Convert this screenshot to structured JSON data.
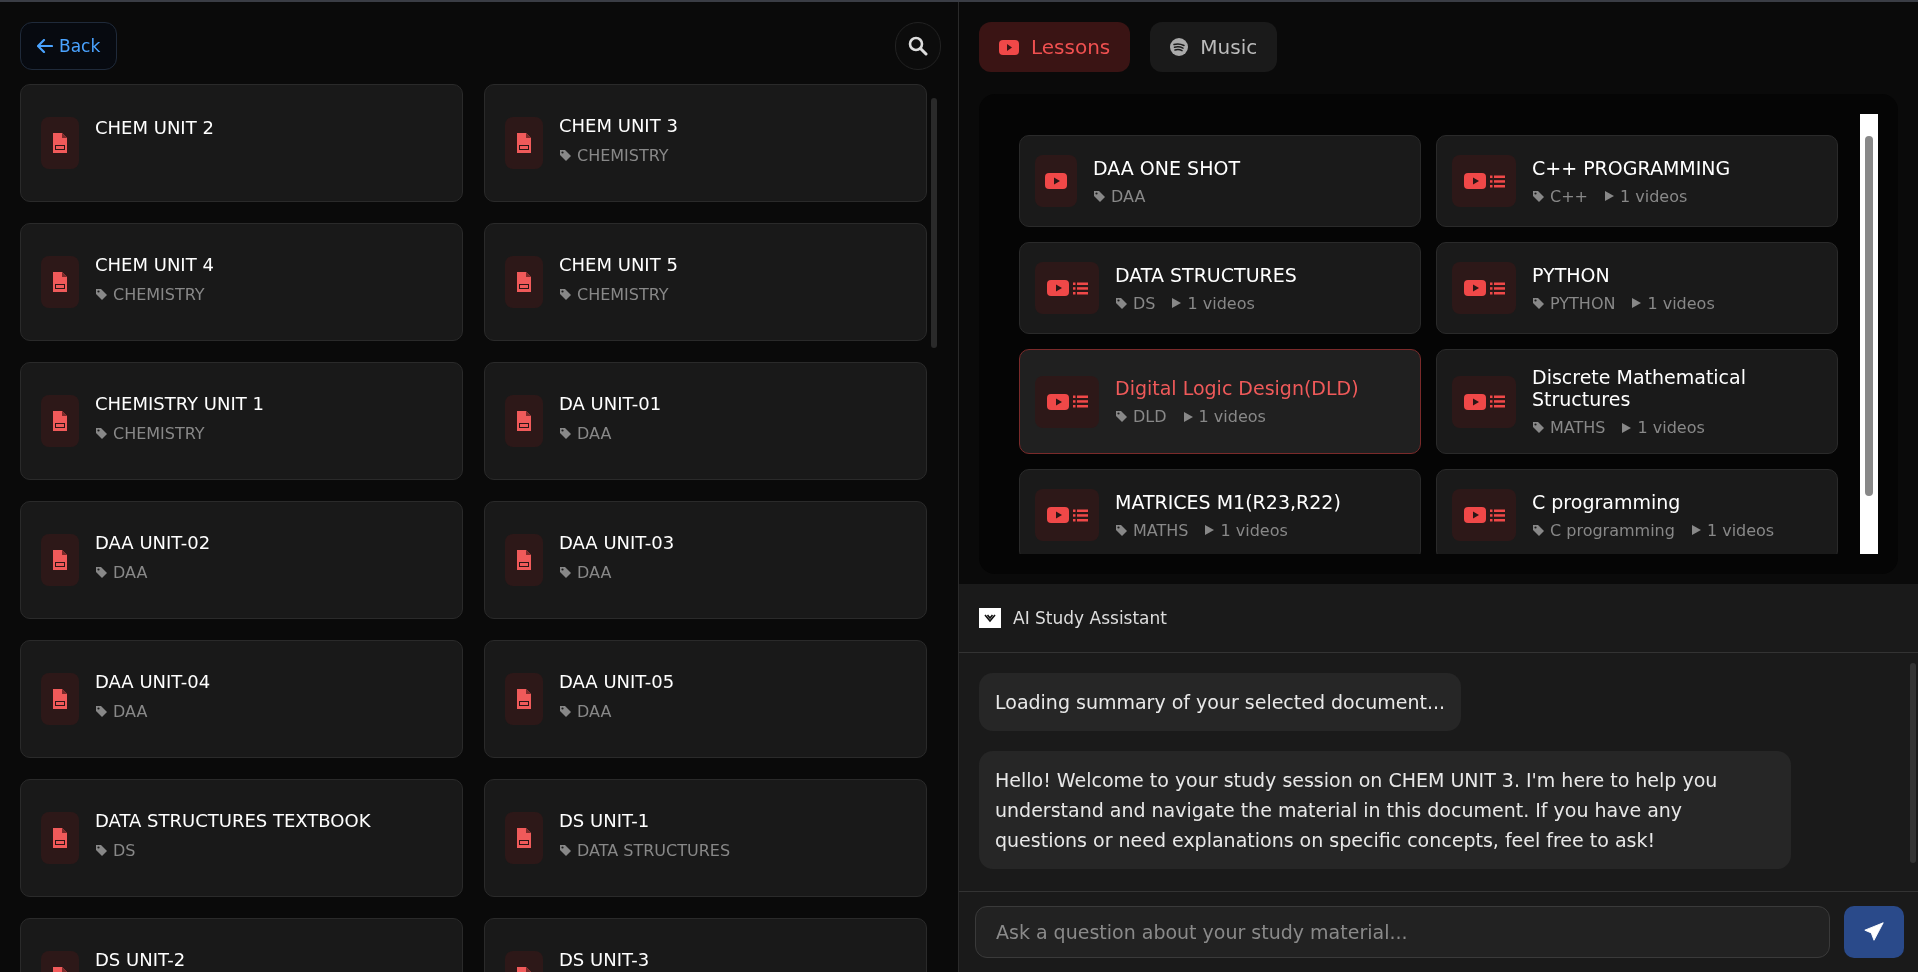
{
  "header": {
    "back": "Back"
  },
  "documents": [
    {
      "title": "CHEM UNIT 2"
    },
    {
      "title": "CHEM UNIT 3",
      "tag": "CHEMISTRY"
    },
    {
      "title": "CHEM UNIT 4",
      "tag": "CHEMISTRY"
    },
    {
      "title": "CHEM UNIT 5",
      "tag": "CHEMISTRY"
    },
    {
      "title": "CHEMISTRY UNIT 1",
      "tag": "CHEMISTRY"
    },
    {
      "title": "DA UNIT-01",
      "tag": "DAA"
    },
    {
      "title": "DAA UNIT-02",
      "tag": "DAA"
    },
    {
      "title": "DAA UNIT-03",
      "tag": "DAA"
    },
    {
      "title": "DAA UNIT-04",
      "tag": "DAA"
    },
    {
      "title": "DAA UNIT-05",
      "tag": "DAA"
    },
    {
      "title": "DATA STRUCTURES TEXTBOOK",
      "tag": "DS"
    },
    {
      "title": "DS UNIT-1",
      "tag": "DATA STRUCTURES"
    },
    {
      "title": "DS UNIT-2"
    },
    {
      "title": "DS UNIT-3"
    }
  ],
  "tabs": [
    {
      "label": "Lessons",
      "kind": "video",
      "selected": true
    },
    {
      "label": "Music",
      "kind": "music",
      "selected": false
    }
  ],
  "lessons": [
    {
      "title": "DAA ONE SHOT",
      "tag": "DAA",
      "kind": "video",
      "selected": false
    },
    {
      "title": "C++ PROGRAMMING",
      "tag": "C++",
      "count": "1 videos",
      "kind": "playlist",
      "selected": false
    },
    {
      "title": "DATA STRUCTURES",
      "tag": "DS",
      "count": "1 videos",
      "kind": "playlist",
      "selected": false
    },
    {
      "title": "PYTHON",
      "tag": "PYTHON",
      "count": "1 videos",
      "kind": "playlist",
      "selected": false
    },
    {
      "title": "Digital Logic Design(DLD)",
      "tag": "DLD",
      "count": "1 videos",
      "kind": "playlist",
      "selected": true
    },
    {
      "title": "Discrete Mathematical Structures",
      "tag": "MATHS",
      "count": "1 videos",
      "kind": "playlist",
      "selected": false
    },
    {
      "title": "MATRICES M1(R23,R22)",
      "tag": "MATHS",
      "count": "1 videos",
      "kind": "playlist",
      "selected": false
    },
    {
      "title": "C programming",
      "tag": "C programming",
      "count": "1 videos",
      "kind": "playlist",
      "selected": false
    }
  ],
  "assistant": {
    "title": "AI Study Assistant",
    "expanded": true,
    "messages": [
      {
        "text": "Loading summary of your selected document..."
      },
      {
        "text": "Hello! Welcome to your study session on CHEM UNIT 3. I'm here to help you understand and navigate the material in this document. If you have any questions or need explanations on specific concepts, feel free to ask!"
      }
    ],
    "input": {
      "placeholder": "Ask a question about your study material..."
    }
  }
}
